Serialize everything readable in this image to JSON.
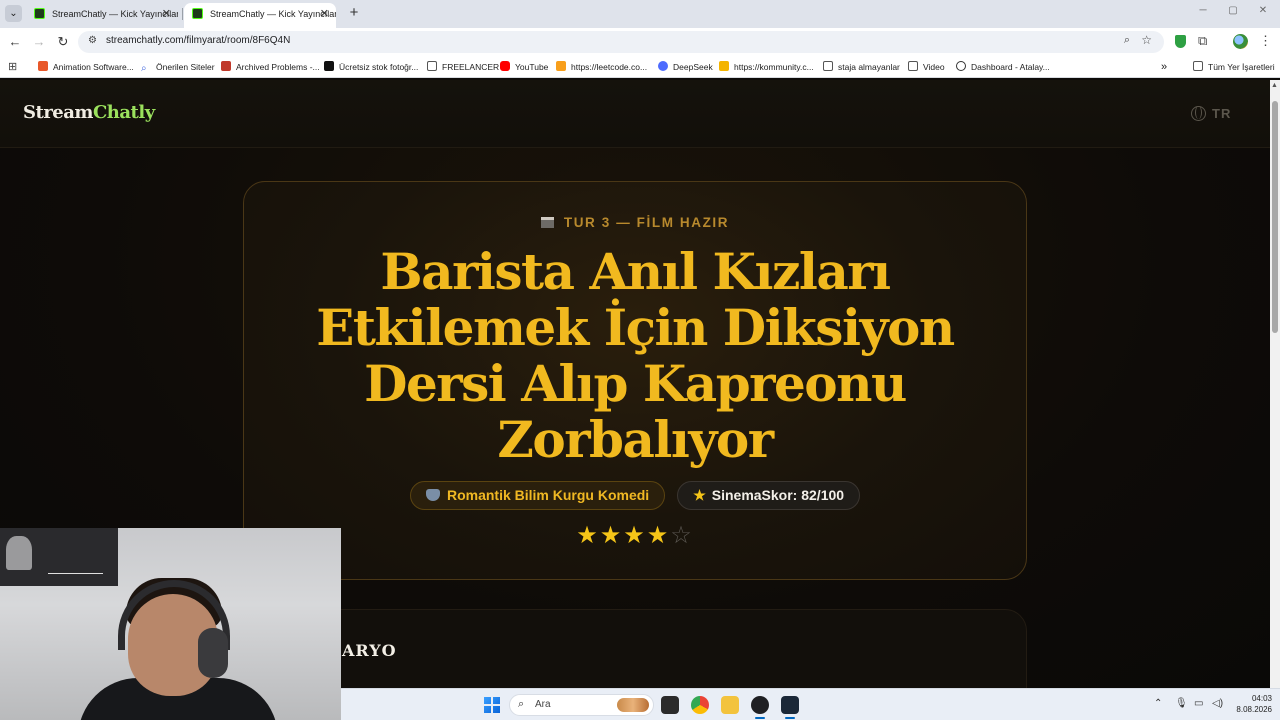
{
  "browser": {
    "tabs": [
      {
        "title": "StreamChatly — Kick Yayıncıları",
        "active": false
      },
      {
        "title": "StreamChatly — Kick Yayıncıları",
        "active": true
      }
    ],
    "url": "streamchatly.com/filmyarat/room/8F6Q4N",
    "bookmarks": [
      {
        "label": "Animation Software...",
        "icon": "v-logo-icon",
        "color": "#e8582a"
      },
      {
        "label": "Önerilen Siteler",
        "icon": "search-icon",
        "color": "#4a6ee0"
      },
      {
        "label": "Archived Problems -...",
        "icon": "pe-icon",
        "color": "#c0392b"
      },
      {
        "label": "Ücretsiz stok fotoğr...",
        "icon": "pexels-icon",
        "color": "#111111"
      },
      {
        "label": "FREELANCER",
        "icon": "folder-icon",
        "color": "#555555"
      },
      {
        "label": "YouTube",
        "icon": "youtube-icon",
        "color": "#ff0000"
      },
      {
        "label": "https://leetcode.co...",
        "icon": "leetcode-icon",
        "color": "#f89f1b"
      },
      {
        "label": "DeepSeek",
        "icon": "deepseek-icon",
        "color": "#4d6bfe"
      },
      {
        "label": "https://kommunity.c...",
        "icon": "k-icon",
        "color": "#f4b400"
      },
      {
        "label": "staja almayanlar",
        "icon": "folder-icon",
        "color": "#555555"
      },
      {
        "label": "Video",
        "icon": "folder-icon",
        "color": "#555555"
      },
      {
        "label": "Dashboard - Atalay...",
        "icon": "globe-icon",
        "color": "#333333"
      }
    ],
    "all_bookmarks_label": "Tüm Yer İşaretleri"
  },
  "site": {
    "brand_part1": "Stream",
    "brand_part2": "Chatly",
    "language": "TR"
  },
  "hero": {
    "round_label": "TUR 3 — FİLM HAZIR",
    "film_title": "Barista Anıl Kızları Etkilemek İçin Diksiyon Dersi Alıp Kapreonu Zorbalıyor",
    "genre": "Romantik Bilim Kurgu Komedi",
    "score_label": "SinemaSkor: 82/100",
    "rating_stars": 4,
    "rating_max": 5
  },
  "second_section": {
    "title_visible": "ARYO"
  },
  "taskbar": {
    "search_placeholder": "Ara",
    "time": "04:03",
    "date": "8.08.2026"
  },
  "colors": {
    "accent_gold": "#f1b91f",
    "brand_green": "#9be15d",
    "page_bg": "#0d0b09"
  }
}
